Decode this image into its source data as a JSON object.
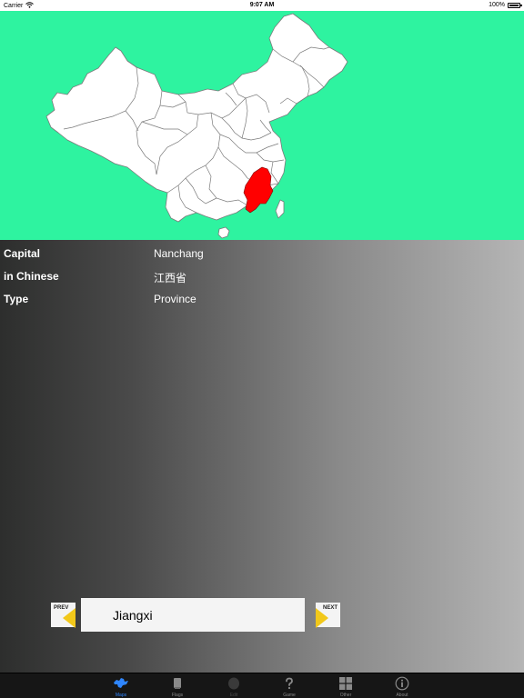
{
  "status_bar": {
    "carrier": "Carrier",
    "time": "9:07 AM",
    "battery": "100%"
  },
  "map": {
    "land_color": "#ffffff",
    "border_color": "#7a7a7a",
    "highlight_color": "#ff0000",
    "background_color": "#2ef3a0",
    "highlighted_region": "Jiangxi"
  },
  "info": {
    "rows": [
      {
        "label": "Capital",
        "value": "Nanchang"
      },
      {
        "label": "in Chinese",
        "value": "江西省"
      },
      {
        "label": "Type",
        "value": "Province"
      }
    ]
  },
  "navigator": {
    "prev_label": "PREV",
    "next_label": "NEXT",
    "current_name": "Jiangxi"
  },
  "tab_bar": {
    "accent_color": "#2f86ff",
    "tabs": [
      {
        "label": "Maps",
        "icon": "map-icon",
        "state": "active"
      },
      {
        "label": "Flags",
        "icon": "flag-icon",
        "state": "normal"
      },
      {
        "label": "Edit",
        "icon": "edit-icon",
        "state": "disabled"
      },
      {
        "label": "Game",
        "icon": "question-icon",
        "state": "normal"
      },
      {
        "label": "Other",
        "icon": "grid-icon",
        "state": "normal"
      },
      {
        "label": "About",
        "icon": "info-icon",
        "state": "normal"
      }
    ]
  }
}
